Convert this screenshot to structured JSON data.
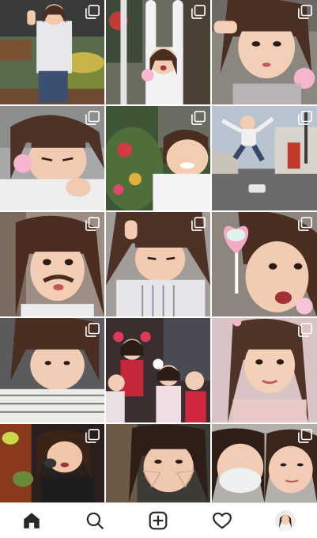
{
  "feed": {
    "posts": [
      {
        "subject": "girl-waving-outdoors",
        "multi": true
      },
      {
        "subject": "girl-arms-up-street",
        "multi": true
      },
      {
        "subject": "girl-closeup-frame-hand",
        "multi": true
      },
      {
        "subject": "girl-lying-closeup",
        "multi": true
      },
      {
        "subject": "girl-with-flowers",
        "multi": true
      },
      {
        "subject": "girl-jumping-street",
        "multi": true
      },
      {
        "subject": "girl-hair-mustache",
        "multi": true
      },
      {
        "subject": "girl-looking-down",
        "multi": true
      },
      {
        "subject": "girl-heart-lollipop",
        "multi": true
      },
      {
        "subject": "girl-bangs-closeup",
        "multi": true
      },
      {
        "subject": "group-stage-costumes",
        "multi": false
      },
      {
        "subject": "girl-pink-background",
        "multi": true
      },
      {
        "subject": "girl-singing-microphone",
        "multi": true
      },
      {
        "subject": "girl-hands-on-cheeks",
        "multi": false
      },
      {
        "subject": "two-girls-mask-selfie",
        "multi": true
      }
    ]
  },
  "tabbar": {
    "items": [
      "home",
      "search",
      "new-post",
      "activity",
      "profile"
    ],
    "active": "home",
    "icon_color": "#262626"
  }
}
